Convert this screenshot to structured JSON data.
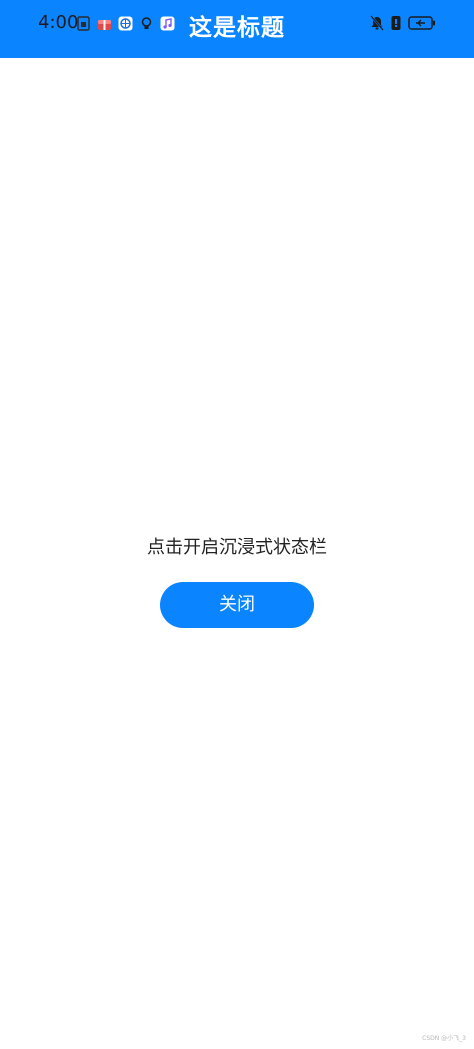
{
  "status_bar": {
    "time": "4:00",
    "notification_icons": [
      "sim-icon",
      "gift-icon",
      "browser-icon",
      "bulb-icon",
      "music-icon"
    ],
    "right_icons": [
      "bell-off-icon",
      "vibrate-icon",
      "battery-charging-icon"
    ]
  },
  "header": {
    "title": "这是标题",
    "background": "#0a84ff"
  },
  "main": {
    "label": "点击开启沉浸式状态栏",
    "button_label": "关闭",
    "button_color": "#0a84ff"
  },
  "watermark": "CSDN @小飞_3"
}
